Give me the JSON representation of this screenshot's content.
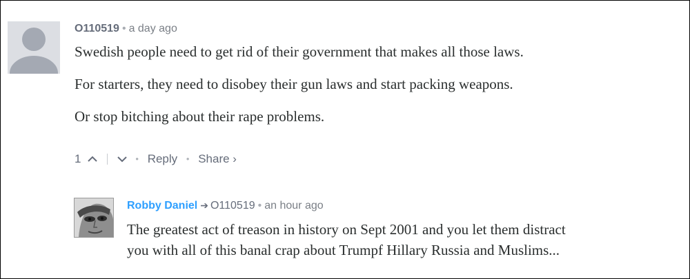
{
  "comments": [
    {
      "author": "O110519",
      "time": "a day ago",
      "paragraphs": [
        "Swedish people need to get rid of their government that makes all those laws.",
        "For starters, they need to disobey their gun laws and start packing weapons.",
        "Or stop bitching about their rape problems."
      ],
      "votes": "1",
      "reply_label": "Reply",
      "share_label": "Share ›"
    }
  ],
  "reply": {
    "author": "Robby Daniel",
    "parent": "O110519",
    "time": "an hour ago",
    "lines": [
      "The greatest act of treason in history on Sept 2001 and you let them distract",
      "you with all of this banal crap about Trumpf Hillary Russia and Muslims..."
    ]
  },
  "separators": {
    "dot": "•"
  },
  "colors": {
    "link_blue": "#2e9fff",
    "meta_gray": "#656c7a",
    "text": "#2a2e2e"
  },
  "icons": [
    "default-avatar-icon",
    "upvote-chevron-icon",
    "downvote-chevron-icon",
    "reply-arrow-icon",
    "user-photo-avatar"
  ]
}
